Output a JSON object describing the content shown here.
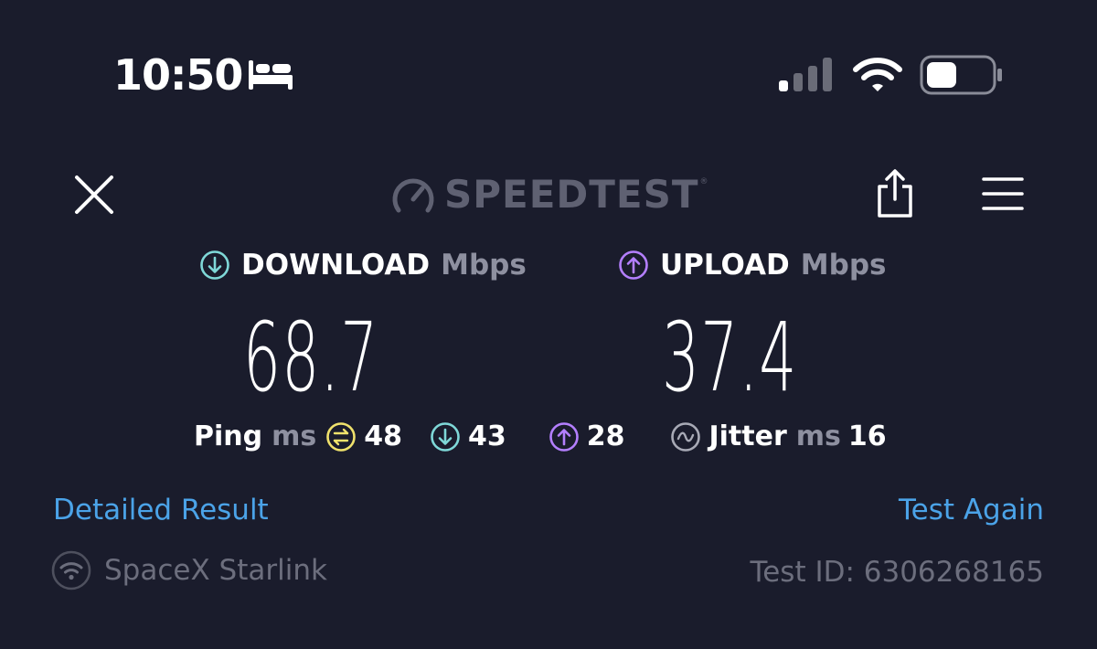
{
  "status_bar": {
    "time": "10:50",
    "icons": [
      "bed-icon",
      "cellular-signal-icon",
      "wifi-icon",
      "battery-icon"
    ]
  },
  "header": {
    "logo_text": "SPEEDTEST",
    "logo_mark": "®",
    "close_icon": "close-icon",
    "share_icon": "share-icon",
    "menu_icon": "hamburger-menu-icon"
  },
  "download": {
    "label": "DOWNLOAD",
    "unit": "Mbps",
    "value": "68.7",
    "icon": "download-arrow-icon",
    "color": "#7fd8d8"
  },
  "upload": {
    "label": "UPLOAD",
    "unit": "Mbps",
    "value": "37.4",
    "icon": "upload-arrow-icon",
    "color": "#b47fff"
  },
  "ping": {
    "label": "Ping",
    "unit": "ms",
    "idle": "48",
    "idle_color": "#f0e26c",
    "download": "43",
    "upload": "28"
  },
  "jitter": {
    "label": "Jitter",
    "unit": "ms",
    "value": "16"
  },
  "links": {
    "detailed_result": "Detailed Result",
    "test_again": "Test Again",
    "color": "#4ba3e8"
  },
  "footer": {
    "provider": "SpaceX Starlink",
    "test_id": "Test ID: 6306268165"
  }
}
